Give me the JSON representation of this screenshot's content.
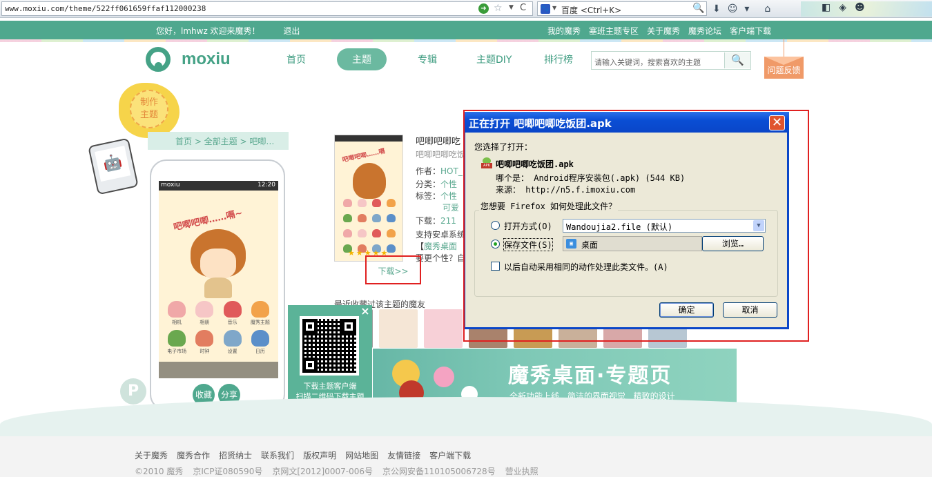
{
  "browser": {
    "url": "www.moxiu.com/theme/522ff061659ffaf112000238",
    "search_placeholder": "百度 <Ctrl+K>",
    "search_engine_glyph": "🐾",
    "go_glyph": "➜",
    "star_glyph": "☆",
    "reload_glyph": "C",
    "magnifier_glyph": "🔍",
    "download_glyph": "⬇",
    "addon_glyph": "☺",
    "home_glyph": "⌂",
    "extra_glyphs": [
      "◧",
      "◈",
      "☻"
    ]
  },
  "topbar": {
    "greeting": "您好，lmhwz 欢迎来魔秀！",
    "logout": "退出",
    "links": [
      "我的魔秀",
      "塞班主题专区",
      "关于魔秀",
      "魔秀论坛",
      "客户端下载"
    ]
  },
  "header": {
    "logo_text": "moxiu",
    "nav": [
      "首页",
      "主题",
      "专辑",
      "主题DIY",
      "排行榜"
    ],
    "active_nav": "主题",
    "search_placeholder": "请输入关键词，搜索喜欢的主题",
    "search_glyph": "🔍",
    "feedback": "问题反馈"
  },
  "left": {
    "make_badge_line1": "制作",
    "make_badge_line2": "主题",
    "android_glyph": "🤖",
    "breadcrumb": "首页 > 全部主题 > 吧唧…",
    "phone": {
      "carrier": "moxiu",
      "time": "12:20",
      "title": "吧唧吧唧……嗝~",
      "icons": [
        {
          "label": "相机",
          "color": "#f0a8a8"
        },
        {
          "label": "相册",
          "color": "#f6c6c6"
        },
        {
          "label": "音乐",
          "color": "#e05a5a"
        },
        {
          "label": "魔秀主题",
          "color": "#f2a24a"
        },
        {
          "label": "电子市场",
          "color": "#6aa84f"
        },
        {
          "label": "时钟",
          "color": "#e27d60"
        },
        {
          "label": "设置",
          "color": "#7fa7c9"
        },
        {
          "label": "日历",
          "color": "#5b8fc9"
        }
      ],
      "collect_button": "收藏",
      "share_button": "分享"
    }
  },
  "theme": {
    "title": "吧唧吧唧吃",
    "subtitle": "吧唧吧唧吃饭",
    "author_label": "作者：",
    "author_value": "HOT_",
    "category_label": "分类：",
    "category_value": "个性",
    "tags_label": "标签：",
    "tags_value": "个性",
    "tags_value2": "可爱",
    "downloads_label": "下载：",
    "downloads_value": "211",
    "support_text": "支持安卓系统",
    "desktop_prefix": "【",
    "desktop_link": "魔秀桌面",
    "more_text": "要更个性？自",
    "stars": "★★★★★",
    "download_link": "下载>>",
    "thumb_title": "吧唧吧唧……嗝",
    "favorites_title": "最近收藏过该主题的魔友",
    "favorites_colors": [
      "#9e9e9e",
      "#f5e6d6",
      "#f7d0d7",
      "#a9826c",
      "#c89b54",
      "#c9b09a",
      "#d8a8a8",
      "#b7c7d3"
    ]
  },
  "qr": {
    "close": "×",
    "caption_line1": "下载主题客户端",
    "caption_line2": "扫描二维码下载主题"
  },
  "banner": {
    "title": "魔秀桌面·专题页",
    "subtitle": "全新功能上线 简洁的界面视觉 精致的设计"
  },
  "footer": {
    "p_badge": "P",
    "links": [
      "关于魔秀",
      "魔秀合作",
      "招贤纳士",
      "联系我们",
      "版权声明",
      "网站地图",
      "友情链接",
      "客户端下载"
    ],
    "copyright": [
      "©2010 魔秀",
      "京ICP证080590号",
      "京网文[2012]0007-006号",
      "京公网安备110105006728号",
      "营业执照"
    ]
  },
  "dialog": {
    "title": "正在打开 吧唧吧唧吃饭团.apk",
    "close": "✕",
    "you_chose": "您选择了打开：",
    "filename": "吧唧吧唧吃饭团.apk",
    "which_is": "哪个是： Android程序安装包(.apk) (544 KB)",
    "from": "来源： http://n5.f.imoxiu.com",
    "question": "您想要 Firefox 如何处理此文件？",
    "open_with_label": "打开方式(O)",
    "open_with_value": "Wandoujia2.file (默认)",
    "save_file_label": "保存文件(S)",
    "save_location": "桌面",
    "browse_button": "浏览…",
    "auto_action_label": "以后自动采用相同的动作处理此类文件。(A)",
    "ok_button": "确定",
    "cancel_button": "取消",
    "selected_option": "save",
    "auto_checked": false
  }
}
